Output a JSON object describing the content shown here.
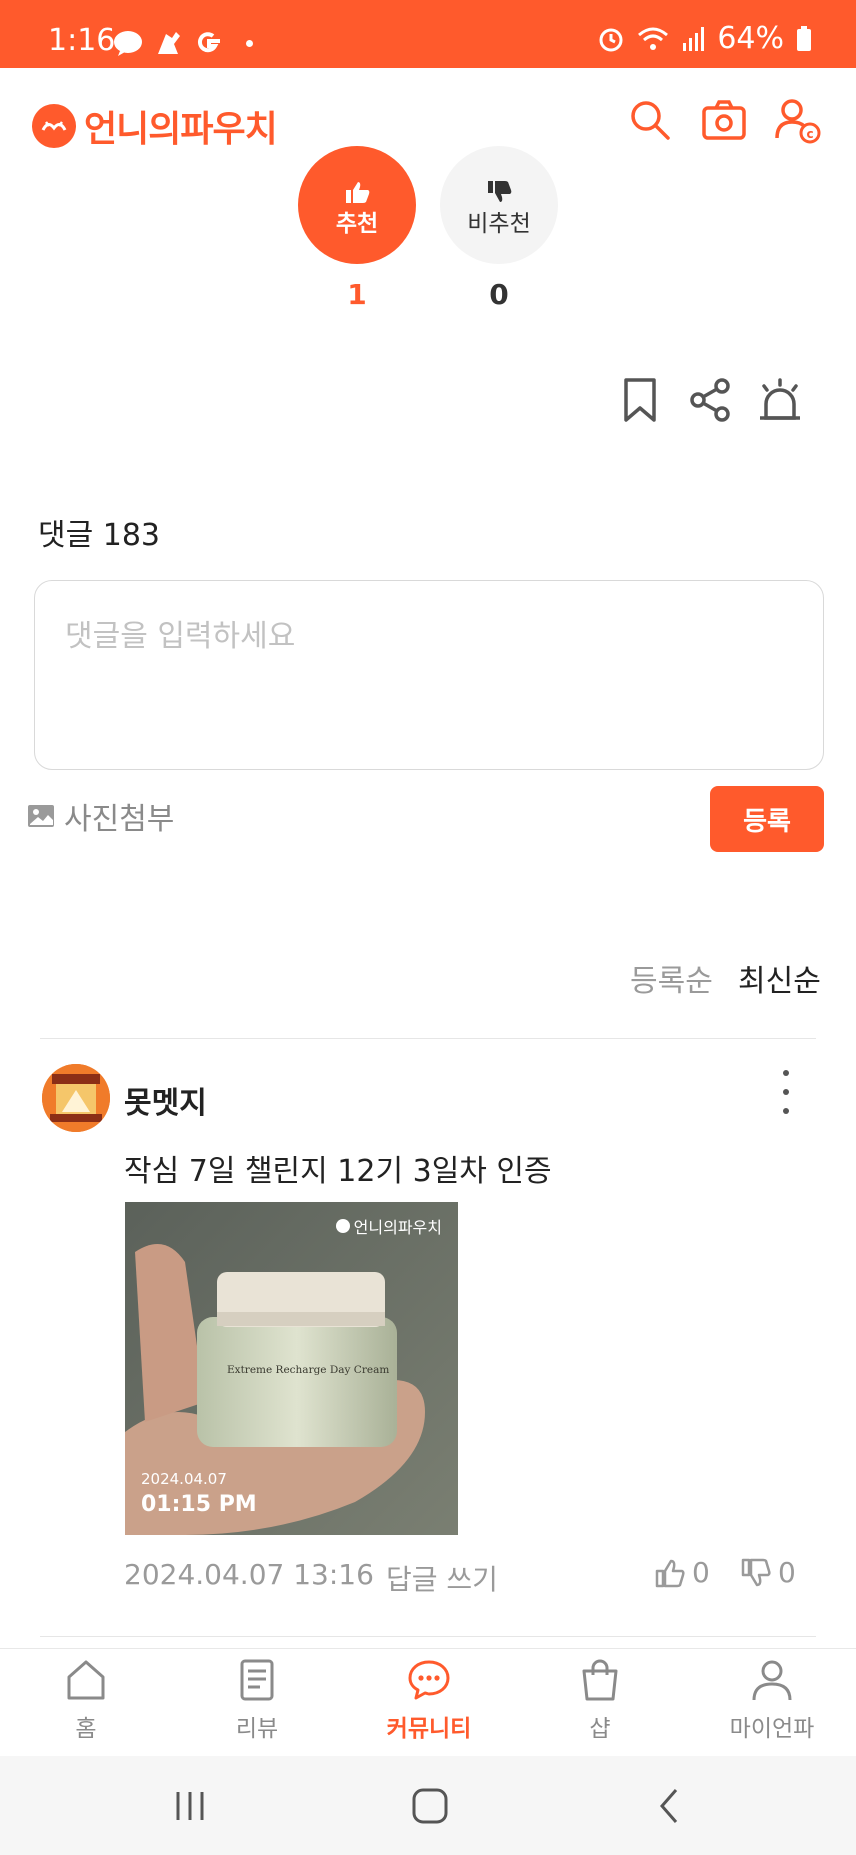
{
  "status_bar": {
    "time": "1:16",
    "battery": "64%"
  },
  "header": {
    "app_name": "언니의파우치",
    "brand_color": "#ff5a2c",
    "icons": [
      "search-icon",
      "camera-icon",
      "profile-icon"
    ]
  },
  "vote": {
    "up_label": "추천",
    "up_count": "1",
    "down_label": "비추천",
    "down_count": "0"
  },
  "actions": [
    "bookmark-icon",
    "share-icon",
    "report-icon"
  ],
  "comments": {
    "title": "댓글 183",
    "input_placeholder": "댓글을 입력하세요",
    "attach_label": "사진첨부",
    "submit_label": "등록",
    "sort_options": [
      "등록순",
      "최신순"
    ],
    "sort_selected": "최신순",
    "items": [
      {
        "author": "못멧지",
        "text": "작심 7일 챌린지 12기 3일차 인증",
        "photo": {
          "watermark": "언니의파우치",
          "product_name": "Extreme Recharge Day Cream",
          "date": "2024.04.07",
          "time": "01:15 PM"
        },
        "datetime": "2024.04.07 13:16",
        "reply_label": "답글 쓰기",
        "likes": "0",
        "dislikes": "0"
      }
    ]
  },
  "bottom_nav": {
    "items": [
      {
        "label": "홈",
        "icon": "home-icon"
      },
      {
        "label": "리뷰",
        "icon": "review-icon"
      },
      {
        "label": "커뮤니티",
        "icon": "chat-icon"
      },
      {
        "label": "샵",
        "icon": "shopping-bag-icon"
      },
      {
        "label": "마이언파",
        "icon": "user-icon"
      }
    ],
    "active": "커뮤니티"
  }
}
